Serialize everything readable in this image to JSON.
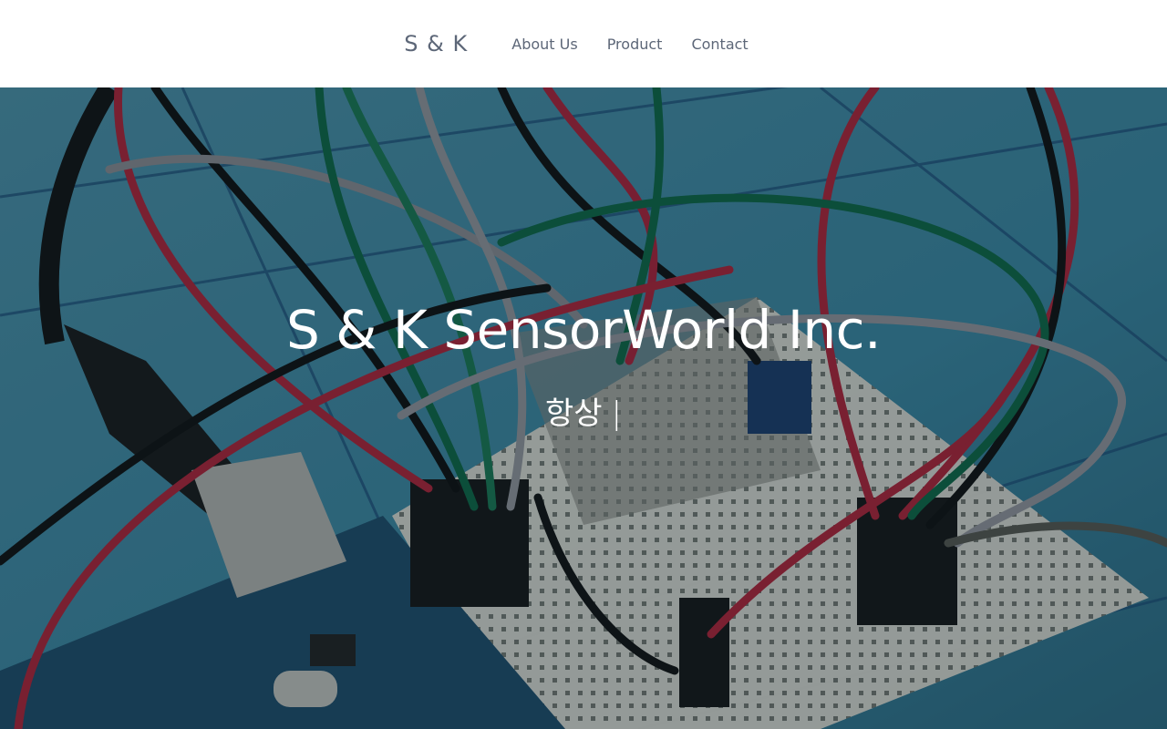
{
  "nav": {
    "brand": "S & K",
    "links": [
      "About Us",
      "Product",
      "Contact"
    ]
  },
  "hero": {
    "title": "S & K SensorWorld Inc.",
    "typed_text": "항상",
    "cursor": "|",
    "background_image": "arduino-breadboard-wires-photo"
  },
  "colors": {
    "nav_text": "#5d6778",
    "hero_text": "#ffffff",
    "hero_bg": "#3f7f95"
  }
}
